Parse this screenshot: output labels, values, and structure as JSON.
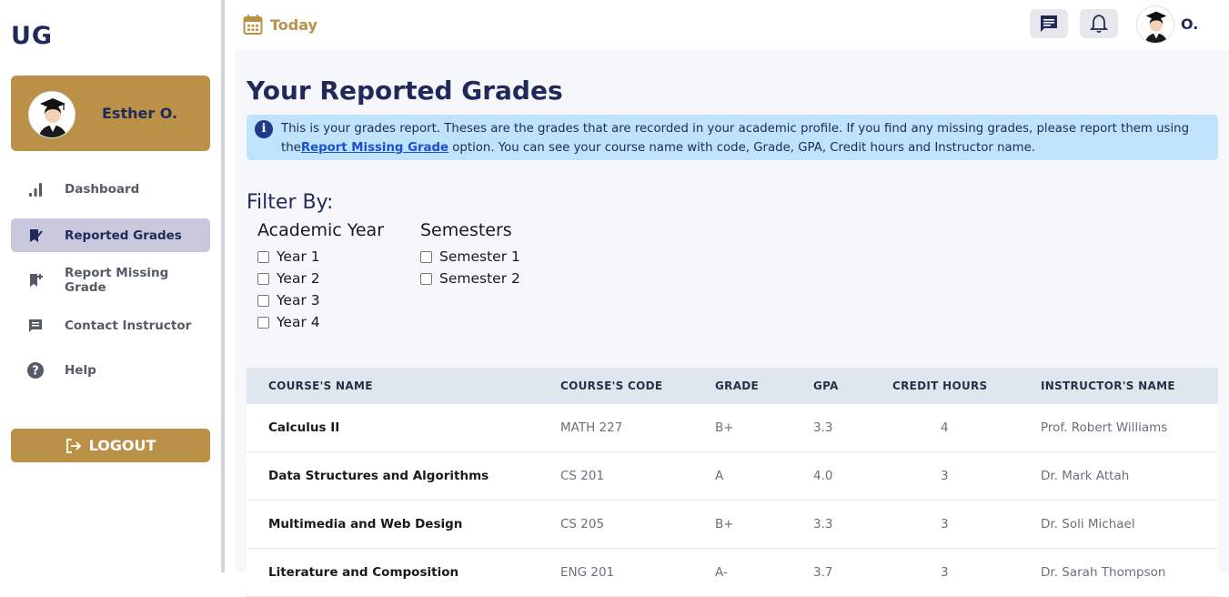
{
  "app": {
    "logo": "UG"
  },
  "profile": {
    "name": "Esther O."
  },
  "sidebar": {
    "items": [
      {
        "label": "Dashboard",
        "icon": "bar-chart-icon",
        "active": false
      },
      {
        "label": "Reported Grades",
        "icon": "bookmark-check-icon",
        "active": true
      },
      {
        "label": "Report Missing Grade",
        "icon": "bookmark-add-icon",
        "active": false
      },
      {
        "label": "Contact Instructor",
        "icon": "chat-icon",
        "active": false
      },
      {
        "label": "Help",
        "icon": "help-circle-icon",
        "active": false
      }
    ],
    "logout_label": "LOGOUT"
  },
  "topbar": {
    "today_label": "Today",
    "user_initial": "O."
  },
  "main": {
    "title": "Your Reported Grades",
    "info": {
      "text_before": "This is your grades report. Theses are the grades that are recorded in your academic profile. If you find any missing grades, please report them using the",
      "link_text": "Report Missing Grade",
      "text_after": " option. You can see your course name with code, Grade, GPA, Credit hours and Instructor name."
    },
    "filter": {
      "title": "Filter By:",
      "year_title": "Academic Year",
      "years": [
        "Year 1",
        "Year 2",
        "Year 3",
        "Year 4"
      ],
      "semester_title": "Semesters",
      "semesters": [
        "Semester 1",
        "Semester 2"
      ]
    },
    "table": {
      "headers": [
        "COURSE'S NAME",
        "COURSE'S CODE",
        "GRADE",
        "GPA",
        "CREDIT HOURS",
        "INSTRUCTOR'S NAME"
      ],
      "rows": [
        [
          "Calculus II",
          "MATH 227",
          "B+",
          "3.3",
          "4",
          "Prof. Robert Williams"
        ],
        [
          "Data Structures and Algorithms",
          "CS 201",
          "A",
          "4.0",
          "3",
          "Dr. Mark Attah"
        ],
        [
          "Multimedia and Web Design",
          "CS 205",
          "B+",
          "3.3",
          "3",
          "Dr. Soli Michael"
        ],
        [
          "Literature and Composition",
          "ENG 201",
          "A-",
          "3.7",
          "3",
          "Dr. Sarah Thompson"
        ]
      ]
    }
  },
  "colors": {
    "accent": "#bb9148",
    "navy": "#1f2a5a",
    "info_bg": "#bee3fb",
    "active_nav": "#c9c8dc"
  }
}
